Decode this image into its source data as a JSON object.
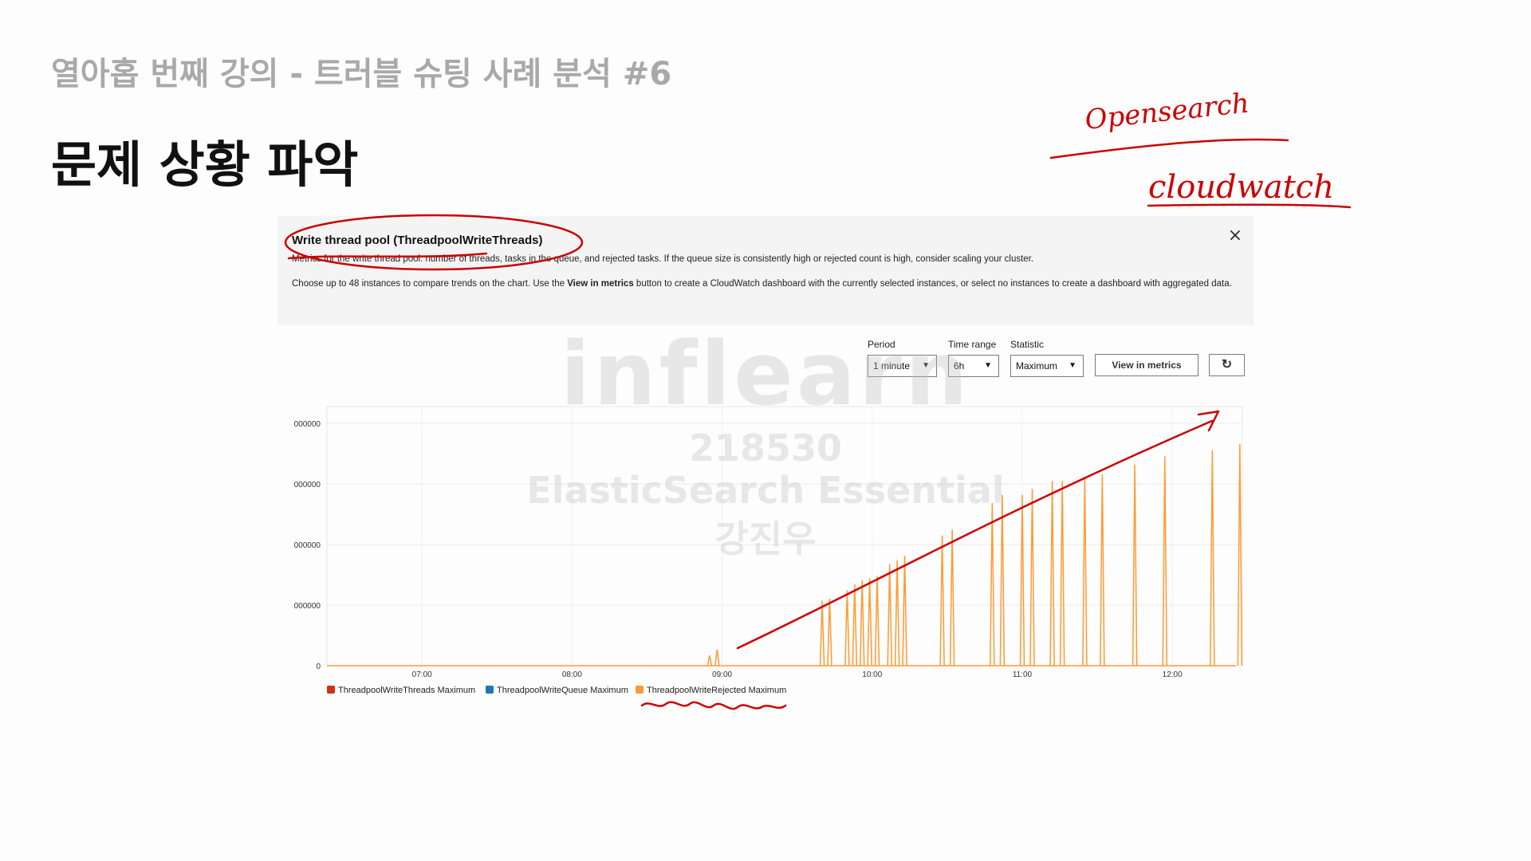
{
  "slide": {
    "subtitle": "열아홉 번째 강의 - 트러블 슈팅 사례 분석 #6",
    "title": "문제 상황 파악"
  },
  "annotations": {
    "handwriting_1": "Opensearch",
    "handwriting_2": "cloudwatch"
  },
  "panel": {
    "title": "Write thread pool (ThreadpoolWriteThreads)",
    "description": "Metrics for the write thread pool: number of threads, tasks in the queue, and rejected tasks. If the queue size is consistently high or rejected count is high, consider scaling your cluster.",
    "note_before": "Choose up to 48 instances to compare trends on the chart. Use the ",
    "note_bold": "View in metrics",
    "note_after": " button to create a CloudWatch dashboard with the currently selected instances, or select no instances to create a dashboard with aggregated data.",
    "close_icon": "×"
  },
  "controls": {
    "period": {
      "label": "Period",
      "value": "1 minute"
    },
    "time_range": {
      "label": "Time range",
      "value": "6h"
    },
    "statistic": {
      "label": "Statistic",
      "value": "Maximum"
    },
    "view_in_metrics": "View in metrics",
    "refresh_icon": "↻"
  },
  "watermark": {
    "brand": "inflearn",
    "id": "218530",
    "course": "ElasticSearch Essential",
    "author": "강진우"
  },
  "colors": {
    "threads": "#d13212",
    "queue": "#1f77b4",
    "rejected": "#ff9933",
    "annotation": "#cc0000"
  },
  "chart_data": {
    "type": "line",
    "x_ticks": [
      "07:00",
      "08:00",
      "09:00",
      "10:00",
      "11:00",
      "12:00"
    ],
    "y_ticks": [
      "0",
      "000000",
      "000000",
      "000000",
      "000000"
    ],
    "series": [
      {
        "name": "ThreadpoolWriteThreads Maximum",
        "values": []
      },
      {
        "name": "ThreadpoolWriteQueue Maximum",
        "values": []
      },
      {
        "name": "ThreadpoolWriteRejected Maximum",
        "spike_times_min": [
          115,
          118,
          160,
          163,
          170,
          173,
          176,
          179,
          182,
          187,
          190,
          193,
          208,
          212,
          228,
          232,
          240,
          244,
          252,
          256,
          265,
          272,
          285,
          297,
          316,
          327
        ],
        "spike_levels": [
          0.05,
          0.08,
          0.32,
          0.33,
          0.37,
          0.4,
          0.42,
          0.43,
          0.44,
          0.5,
          0.52,
          0.54,
          0.64,
          0.67,
          0.8,
          0.84,
          0.84,
          0.87,
          0.91,
          0.91,
          0.93,
          0.94,
          0.99,
          1.03,
          1.06,
          1.09
        ]
      }
    ],
    "x_range_min": [
      -38,
      328
    ],
    "grid": true,
    "legend": "bottom-left"
  }
}
